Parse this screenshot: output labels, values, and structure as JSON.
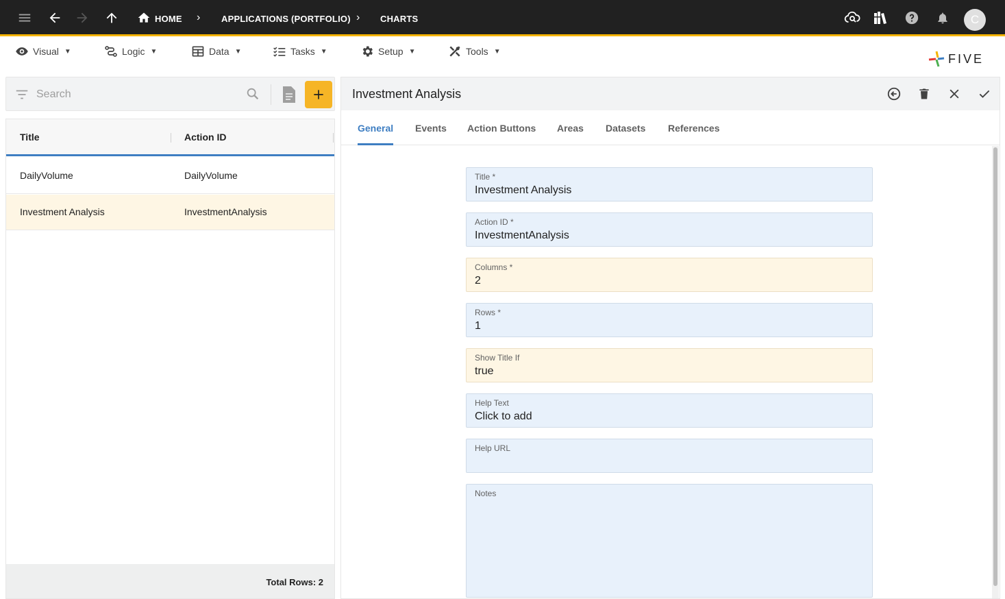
{
  "topbar": {
    "breadcrumbs": [
      "HOME",
      "APPLICATIONS (PORTFOLIO)",
      "CHARTS"
    ],
    "avatar_initial": "C",
    "accent_color": "#f5b400"
  },
  "menu": {
    "items": [
      {
        "label": "Visual",
        "icon": "eye-icon"
      },
      {
        "label": "Logic",
        "icon": "logic-icon"
      },
      {
        "label": "Data",
        "icon": "table-icon"
      },
      {
        "label": "Tasks",
        "icon": "tasks-icon"
      },
      {
        "label": "Setup",
        "icon": "gear-icon"
      },
      {
        "label": "Tools",
        "icon": "tools-icon"
      }
    ],
    "logo_text": "FIVE"
  },
  "left": {
    "search_placeholder": "Search",
    "columns": [
      "Title",
      "Action ID"
    ],
    "rows": [
      {
        "title": "DailyVolume",
        "action_id": "DailyVolume"
      },
      {
        "title": "Investment Analysis",
        "action_id": "InvestmentAnalysis"
      }
    ],
    "total_rows": "Total Rows: 2"
  },
  "form": {
    "title": "Investment Analysis",
    "tabs": [
      "General",
      "Events",
      "Action Buttons",
      "Areas",
      "Datasets",
      "References"
    ],
    "fields": [
      {
        "label": "Title *",
        "value": "Investment Analysis"
      },
      {
        "label": "Action ID *",
        "value": "InvestmentAnalysis"
      },
      {
        "label": "Columns *",
        "value": "2"
      },
      {
        "label": "Rows *",
        "value": "1"
      },
      {
        "label": "Show Title If",
        "value": "true"
      },
      {
        "label": "Help Text",
        "value": "Click to add"
      },
      {
        "label": "Help URL",
        "value": ""
      },
      {
        "label": "Notes",
        "value": ""
      }
    ]
  }
}
